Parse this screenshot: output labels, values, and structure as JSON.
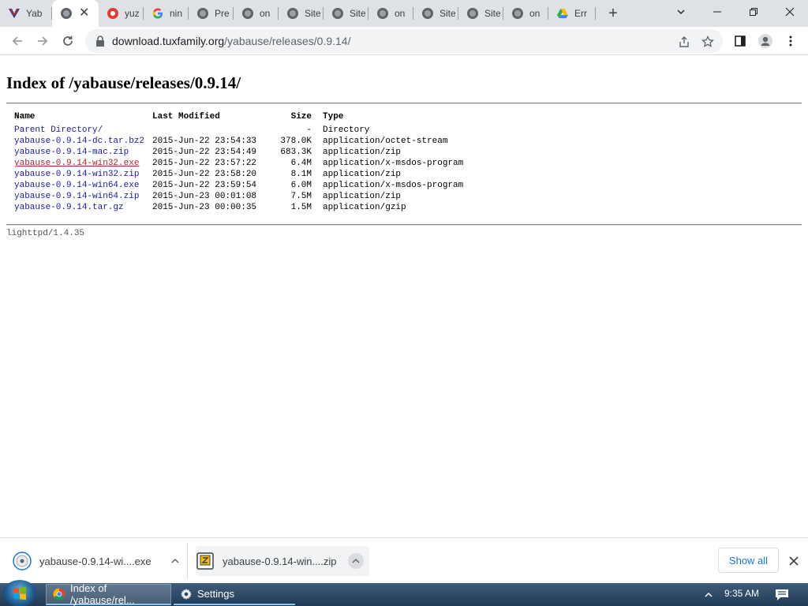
{
  "browser": {
    "tabs": [
      {
        "title": "Yab",
        "icon": "yabause-icon",
        "active": false
      },
      {
        "title": "",
        "icon": "globe-icon",
        "active": true
      },
      {
        "title": "yuz",
        "icon": "red-circle-icon",
        "active": false
      },
      {
        "title": "nin",
        "icon": "google-icon",
        "active": false
      },
      {
        "title": "Pre",
        "icon": "globe-icon",
        "active": false
      },
      {
        "title": "on",
        "icon": "globe-icon",
        "active": false
      },
      {
        "title": "Site",
        "icon": "globe-icon",
        "active": false
      },
      {
        "title": "Site",
        "icon": "globe-icon",
        "active": false
      },
      {
        "title": "on",
        "icon": "globe-icon",
        "active": false
      },
      {
        "title": "Site",
        "icon": "globe-icon",
        "active": false
      },
      {
        "title": "Site",
        "icon": "globe-icon",
        "active": false
      },
      {
        "title": "on",
        "icon": "globe-icon",
        "active": false
      },
      {
        "title": "Err",
        "icon": "drive-icon",
        "active": false
      }
    ],
    "url_host": "download.tuxfamily.org",
    "url_path": "/yabause/releases/0.9.14/"
  },
  "page": {
    "title": "Index of /yabause/releases/0.9.14/",
    "headers": {
      "name": "Name",
      "modified": "Last Modified",
      "size": "Size",
      "type": "Type"
    },
    "rows": [
      {
        "name": "Parent Directory/",
        "modified": "",
        "size": "-",
        "type": "Directory"
      },
      {
        "name": "yabause-0.9.14-dc.tar.bz2",
        "modified": "2015-Jun-22 23:54:33",
        "size": "378.0K",
        "type": "application/octet-stream"
      },
      {
        "name": "yabause-0.9.14-mac.zip",
        "modified": "2015-Jun-22 23:54:49",
        "size": "683.3K",
        "type": "application/zip"
      },
      {
        "name": "yabause-0.9.14-win32.exe",
        "modified": "2015-Jun-22 23:57:22",
        "size": "6.4M",
        "type": "application/x-msdos-program"
      },
      {
        "name": "yabause-0.9.14-win32.zip",
        "modified": "2015-Jun-22 23:58:20",
        "size": "8.1M",
        "type": "application/zip"
      },
      {
        "name": "yabause-0.9.14-win64.exe",
        "modified": "2015-Jun-22 23:59:54",
        "size": "6.0M",
        "type": "application/x-msdos-program"
      },
      {
        "name": "yabause-0.9.14-win64.zip",
        "modified": "2015-Jun-23 00:01:08",
        "size": "7.5M",
        "type": "application/zip"
      },
      {
        "name": "yabause-0.9.14.tar.gz",
        "modified": "2015-Jun-23 00:00:35",
        "size": "1.5M",
        "type": "application/gzip"
      }
    ],
    "footer": "lighttpd/1.4.35"
  },
  "downloads": {
    "items": [
      {
        "name": "yabause-0.9.14-wi....exe"
      },
      {
        "name": "yabause-0.9.14-win....zip"
      }
    ],
    "show_all": "Show all"
  },
  "taskbar": {
    "tasks": [
      {
        "label": "Index of /yabause/rel..."
      },
      {
        "label": "Settings"
      }
    ],
    "clock": "9:35 AM"
  }
}
